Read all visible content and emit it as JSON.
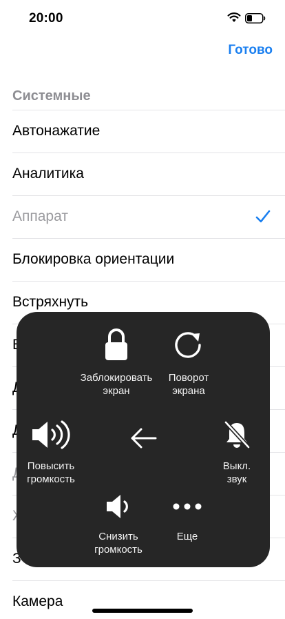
{
  "status_bar": {
    "time": "20:00"
  },
  "header": {
    "done_label": "Готово"
  },
  "section": {
    "title": "Системные"
  },
  "list": {
    "items": [
      {
        "label": "Автонажатие"
      },
      {
        "label": "Аналитика"
      },
      {
        "label": "Аппарат"
      },
      {
        "label": "Блокировка ориентации"
      },
      {
        "label": "Встряхнуть"
      },
      {
        "label": "Б"
      },
      {
        "label": "Д"
      },
      {
        "label": "Д"
      },
      {
        "label": "Д"
      },
      {
        "label": "Ж"
      },
      {
        "label": "З"
      },
      {
        "label": "Камера"
      }
    ]
  },
  "overlay": {
    "lock_screen": {
      "line1": "Заблокировать",
      "line2": "экран"
    },
    "rotate_screen": {
      "line1": "Поворот",
      "line2": "экрана"
    },
    "volume_up": {
      "line1": "Повысить",
      "line2": "громкость"
    },
    "mute": {
      "line1": "Выкл.",
      "line2": "звук"
    },
    "volume_down": {
      "line1": "Снизить",
      "line2": "громкость"
    },
    "more": {
      "line1": "Еще"
    }
  },
  "colors": {
    "accent": "#1a7ff0",
    "overlay_bg": "#262626",
    "secondary_text": "#8e8e93"
  }
}
